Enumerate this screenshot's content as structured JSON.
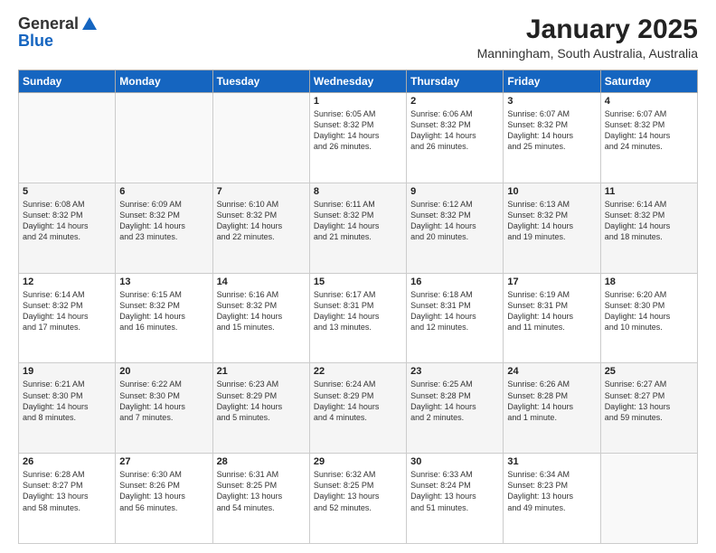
{
  "logo": {
    "general": "General",
    "blue": "Blue"
  },
  "title": "January 2025",
  "subtitle": "Manningham, South Australia, Australia",
  "weekdays": [
    "Sunday",
    "Monday",
    "Tuesday",
    "Wednesday",
    "Thursday",
    "Friday",
    "Saturday"
  ],
  "weeks": [
    [
      {
        "day": "",
        "info": ""
      },
      {
        "day": "",
        "info": ""
      },
      {
        "day": "",
        "info": ""
      },
      {
        "day": "1",
        "info": "Sunrise: 6:05 AM\nSunset: 8:32 PM\nDaylight: 14 hours\nand 26 minutes."
      },
      {
        "day": "2",
        "info": "Sunrise: 6:06 AM\nSunset: 8:32 PM\nDaylight: 14 hours\nand 26 minutes."
      },
      {
        "day": "3",
        "info": "Sunrise: 6:07 AM\nSunset: 8:32 PM\nDaylight: 14 hours\nand 25 minutes."
      },
      {
        "day": "4",
        "info": "Sunrise: 6:07 AM\nSunset: 8:32 PM\nDaylight: 14 hours\nand 24 minutes."
      }
    ],
    [
      {
        "day": "5",
        "info": "Sunrise: 6:08 AM\nSunset: 8:32 PM\nDaylight: 14 hours\nand 24 minutes."
      },
      {
        "day": "6",
        "info": "Sunrise: 6:09 AM\nSunset: 8:32 PM\nDaylight: 14 hours\nand 23 minutes."
      },
      {
        "day": "7",
        "info": "Sunrise: 6:10 AM\nSunset: 8:32 PM\nDaylight: 14 hours\nand 22 minutes."
      },
      {
        "day": "8",
        "info": "Sunrise: 6:11 AM\nSunset: 8:32 PM\nDaylight: 14 hours\nand 21 minutes."
      },
      {
        "day": "9",
        "info": "Sunrise: 6:12 AM\nSunset: 8:32 PM\nDaylight: 14 hours\nand 20 minutes."
      },
      {
        "day": "10",
        "info": "Sunrise: 6:13 AM\nSunset: 8:32 PM\nDaylight: 14 hours\nand 19 minutes."
      },
      {
        "day": "11",
        "info": "Sunrise: 6:14 AM\nSunset: 8:32 PM\nDaylight: 14 hours\nand 18 minutes."
      }
    ],
    [
      {
        "day": "12",
        "info": "Sunrise: 6:14 AM\nSunset: 8:32 PM\nDaylight: 14 hours\nand 17 minutes."
      },
      {
        "day": "13",
        "info": "Sunrise: 6:15 AM\nSunset: 8:32 PM\nDaylight: 14 hours\nand 16 minutes."
      },
      {
        "day": "14",
        "info": "Sunrise: 6:16 AM\nSunset: 8:32 PM\nDaylight: 14 hours\nand 15 minutes."
      },
      {
        "day": "15",
        "info": "Sunrise: 6:17 AM\nSunset: 8:31 PM\nDaylight: 14 hours\nand 13 minutes."
      },
      {
        "day": "16",
        "info": "Sunrise: 6:18 AM\nSunset: 8:31 PM\nDaylight: 14 hours\nand 12 minutes."
      },
      {
        "day": "17",
        "info": "Sunrise: 6:19 AM\nSunset: 8:31 PM\nDaylight: 14 hours\nand 11 minutes."
      },
      {
        "day": "18",
        "info": "Sunrise: 6:20 AM\nSunset: 8:30 PM\nDaylight: 14 hours\nand 10 minutes."
      }
    ],
    [
      {
        "day": "19",
        "info": "Sunrise: 6:21 AM\nSunset: 8:30 PM\nDaylight: 14 hours\nand 8 minutes."
      },
      {
        "day": "20",
        "info": "Sunrise: 6:22 AM\nSunset: 8:30 PM\nDaylight: 14 hours\nand 7 minutes."
      },
      {
        "day": "21",
        "info": "Sunrise: 6:23 AM\nSunset: 8:29 PM\nDaylight: 14 hours\nand 5 minutes."
      },
      {
        "day": "22",
        "info": "Sunrise: 6:24 AM\nSunset: 8:29 PM\nDaylight: 14 hours\nand 4 minutes."
      },
      {
        "day": "23",
        "info": "Sunrise: 6:25 AM\nSunset: 8:28 PM\nDaylight: 14 hours\nand 2 minutes."
      },
      {
        "day": "24",
        "info": "Sunrise: 6:26 AM\nSunset: 8:28 PM\nDaylight: 14 hours\nand 1 minute."
      },
      {
        "day": "25",
        "info": "Sunrise: 6:27 AM\nSunset: 8:27 PM\nDaylight: 13 hours\nand 59 minutes."
      }
    ],
    [
      {
        "day": "26",
        "info": "Sunrise: 6:28 AM\nSunset: 8:27 PM\nDaylight: 13 hours\nand 58 minutes."
      },
      {
        "day": "27",
        "info": "Sunrise: 6:30 AM\nSunset: 8:26 PM\nDaylight: 13 hours\nand 56 minutes."
      },
      {
        "day": "28",
        "info": "Sunrise: 6:31 AM\nSunset: 8:25 PM\nDaylight: 13 hours\nand 54 minutes."
      },
      {
        "day": "29",
        "info": "Sunrise: 6:32 AM\nSunset: 8:25 PM\nDaylight: 13 hours\nand 52 minutes."
      },
      {
        "day": "30",
        "info": "Sunrise: 6:33 AM\nSunset: 8:24 PM\nDaylight: 13 hours\nand 51 minutes."
      },
      {
        "day": "31",
        "info": "Sunrise: 6:34 AM\nSunset: 8:23 PM\nDaylight: 13 hours\nand 49 minutes."
      },
      {
        "day": "",
        "info": ""
      }
    ]
  ]
}
